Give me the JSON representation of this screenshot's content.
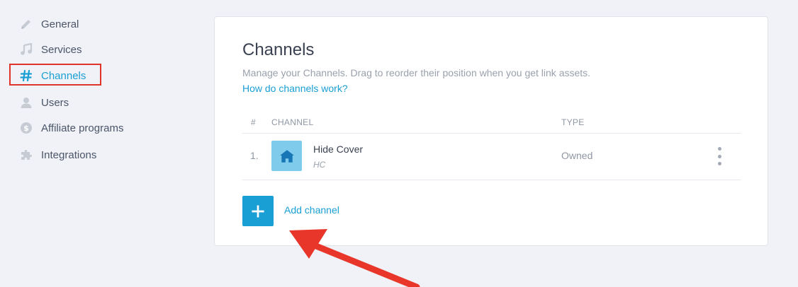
{
  "sidebar": {
    "items": [
      {
        "label": "General",
        "icon": "pencil-icon"
      },
      {
        "label": "Services",
        "icon": "music-note-icon"
      },
      {
        "label": "Channels",
        "icon": "hashtag-icon",
        "active": true
      },
      {
        "label": "Users",
        "icon": "user-icon"
      },
      {
        "label": "Affiliate programs",
        "icon": "dollar-icon"
      },
      {
        "label": "Integrations",
        "icon": "puzzle-icon"
      }
    ]
  },
  "main": {
    "title": "Channels",
    "subtitle": "Manage your Channels. Drag to reorder their position when you get link assets.",
    "help_link": "How do channels work?",
    "table": {
      "headers": [
        "#",
        "CHANNEL",
        "TYPE"
      ],
      "rows": [
        {
          "index": "1.",
          "name": "Hide Cover",
          "code": "HC",
          "type": "Owned",
          "icon": "house-icon"
        }
      ]
    },
    "add_channel_label": "Add channel"
  },
  "colors": {
    "accent": "#1a9fd4",
    "highlight_box": "#e0342b",
    "arrow": "#e8372a",
    "background": "#f0f2f7"
  }
}
